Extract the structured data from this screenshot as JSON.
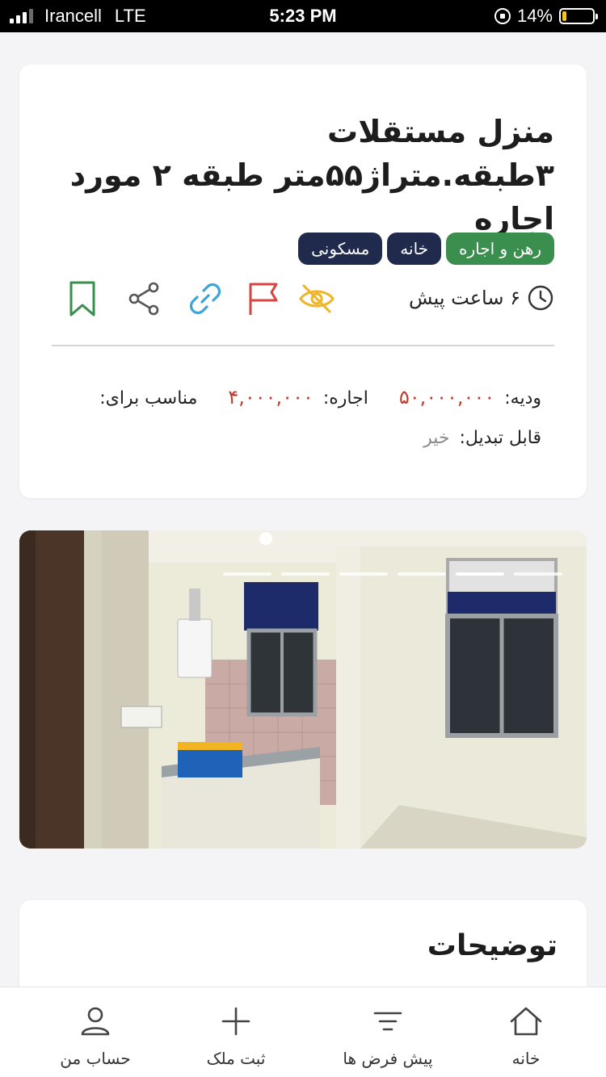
{
  "status_bar": {
    "carrier": "Irancell",
    "network": "LTE",
    "time": "5:23 PM",
    "battery_percent": "14%",
    "battery_level": 0.14
  },
  "listing": {
    "title": "منزل مستقلات ۳طبقه.متراژ۵۵متر طبقه ۲ مورد اجاره",
    "tags": [
      {
        "label": "رهن و اجاره",
        "color": "#3a8f4f"
      },
      {
        "label": "خانه",
        "color": "#1f2a4d"
      },
      {
        "label": "مسکونی",
        "color": "#1f2a4d"
      }
    ],
    "time_ago": "۶ ساعت پیش",
    "icons": {
      "hide": "eye-off-icon",
      "report": "flag-icon",
      "link": "link-icon",
      "share": "share-icon",
      "bookmark": "bookmark-icon"
    },
    "deposit_label": "ودیه:",
    "deposit_value": "۵۰,۰۰۰,۰۰۰",
    "rent_label": "اجاره:",
    "rent_value": "۴,۰۰۰,۰۰۰",
    "suitable_label": "مناسب برای:",
    "exchangeable_label": "قابل تبدیل:",
    "exchangeable_value": "خیر",
    "colors": {
      "price": "#c0392b",
      "muted": "#8a8a8a"
    }
  },
  "gallery": {
    "slide_count": 6,
    "active_index": 4
  },
  "description": {
    "title": "توضیحات"
  },
  "bottom_nav": {
    "home": "خانه",
    "presets": "پیش فرض ها",
    "add_property": "ثبت ملک",
    "account": "حساب من"
  }
}
